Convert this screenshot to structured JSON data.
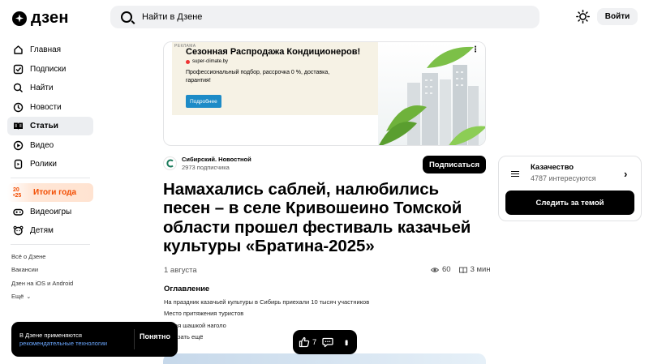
{
  "brand": {
    "name": "дзен"
  },
  "header": {
    "search_placeholder": "Найти в Дзене",
    "login_label": "Войти"
  },
  "sidebar": {
    "items": [
      {
        "label": "Главная",
        "icon": "home-icon"
      },
      {
        "label": "Подписки",
        "icon": "subscriptions-icon"
      },
      {
        "label": "Найти",
        "icon": "search-icon"
      },
      {
        "label": "Новости",
        "icon": "news-icon"
      },
      {
        "label": "Статьи",
        "icon": "articles-icon",
        "active": true
      },
      {
        "label": "Видео",
        "icon": "video-icon"
      },
      {
        "label": "Ролики",
        "icon": "clips-icon"
      }
    ],
    "promo": {
      "icon_text_top": "20",
      "icon_text_bottom": "•25",
      "label": "Итоги года"
    },
    "extra_items": [
      {
        "label": "Видеоигры",
        "icon": "gamepad-icon"
      },
      {
        "label": "Детям",
        "icon": "kids-icon"
      }
    ],
    "footer_links": [
      "Всё о Дзене",
      "Вакансии",
      "Дзен на iOS и Android"
    ],
    "more_label": "Ещё"
  },
  "ad": {
    "badge": "РЕКЛАМА",
    "title": "Сезонная Распродажа Кондиционеров!",
    "domain": "super-climate.by",
    "description": "Профессиональный подбор, рассрочка 0 %, доставка, гарантия!",
    "button_label": "Подробнее"
  },
  "author": {
    "name": "Сибирский. Новостной",
    "subscribers": "2973 подписчика",
    "subscribe_label": "Подписаться"
  },
  "article": {
    "title": "Намахались саблей, налюбились песен – в селе Кривошеино Томской области прошел фестиваль казачьей культуры «Братина-2025»",
    "date": "1 августа",
    "views": "60",
    "read_time": "3 мин",
    "toc_title": "Оглавление",
    "toc": [
      "На праздник казачьей культуры в Сибирь приехали 10 тысяч участников",
      "Место притяжения туристов",
      "Рубая шашкой наголо",
      "Показать ещё"
    ]
  },
  "topic": {
    "name": "Казачество",
    "count": "4787 интересуются",
    "follow_label": "Следить за темой"
  },
  "toast": {
    "text": "В Дзене применяются",
    "link": "рекомендательные технологии",
    "button_label": "Понятно"
  },
  "actions": {
    "likes": "7"
  },
  "colors": {
    "promo": "#f24c00",
    "ad_button": "#1d8bc7",
    "toast_link": "#6aa7ff"
  }
}
